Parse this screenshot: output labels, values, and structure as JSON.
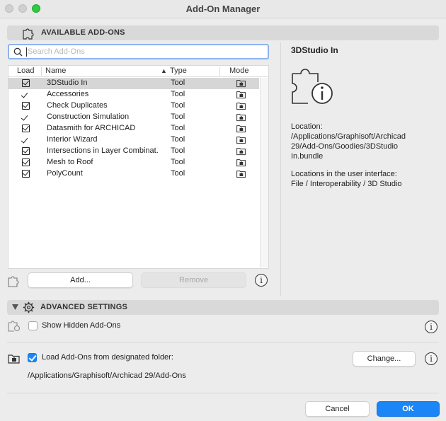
{
  "window": {
    "title": "Add-On Manager"
  },
  "available": {
    "title": "AVAILABLE ADD-ONS",
    "search_placeholder": "Search Add-Ons",
    "columns": {
      "load": "Load",
      "name": "Name",
      "type": "Type",
      "mode": "Mode"
    },
    "sort_indicator": "▲",
    "rows": [
      {
        "name": "3DStudio In",
        "type": "Tool",
        "load": "checkbox",
        "selected": true
      },
      {
        "name": "Accessories",
        "type": "Tool",
        "load": "check"
      },
      {
        "name": "Check Duplicates",
        "type": "Tool",
        "load": "checkbox"
      },
      {
        "name": "Construction Simulation",
        "type": "Tool",
        "load": "check"
      },
      {
        "name": "Datasmith for ARCHICAD",
        "type": "Tool",
        "load": "checkbox"
      },
      {
        "name": "Interior Wizard",
        "type": "Tool",
        "load": "check"
      },
      {
        "name": "Intersections in Layer Combinat...",
        "type": "Tool",
        "load": "checkbox"
      },
      {
        "name": "Mesh to Roof",
        "type": "Tool",
        "load": "checkbox"
      },
      {
        "name": "PolyCount",
        "type": "Tool",
        "load": "checkbox"
      }
    ],
    "add_label": "Add...",
    "remove_label": "Remove"
  },
  "detail": {
    "title": "3DStudio In",
    "location_label": "Location:",
    "location_lines": [
      "/Applications/Graphisoft/Archicad",
      "29/Add-Ons/Goodies/3DStudio",
      "In.bundle"
    ],
    "ui_label": "Locations in the user interface:",
    "ui_path": "File / Interoperability / 3D Studio"
  },
  "advanced": {
    "title": "ADVANCED SETTINGS",
    "show_hidden_label": "Show Hidden Add-Ons",
    "show_hidden_checked": false,
    "load_folder_label": "Load Add-Ons from designated folder:",
    "load_folder_checked": true,
    "change_label": "Change...",
    "folder_path": "/Applications/Graphisoft/Archicad 29/Add-Ons"
  },
  "footer": {
    "cancel_label": "Cancel",
    "ok_label": "OK"
  },
  "colors": {
    "accent": "#1b86f5",
    "selection": "#d6d6d6",
    "window_bg": "#ececec"
  }
}
